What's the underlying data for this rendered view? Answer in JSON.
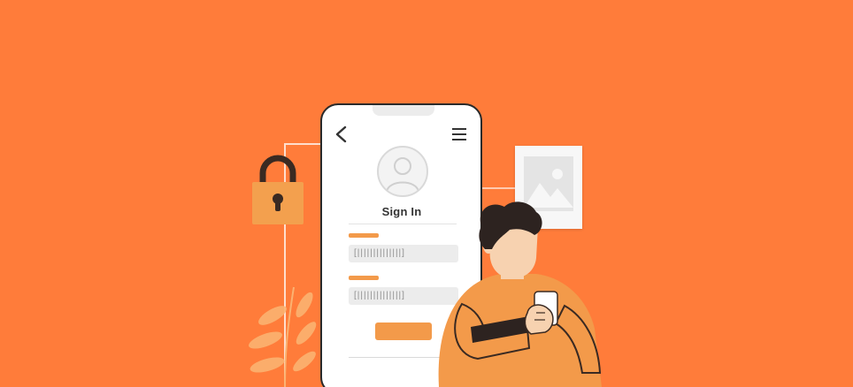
{
  "colors": {
    "background": "#FF7C3A",
    "accent": "#F39A4A",
    "phone_frame": "#2a2a2a",
    "lock": "#F3A04E"
  },
  "icons": {
    "back": "chevron-left-icon",
    "menu": "hamburger-menu-icon",
    "avatar": "user-avatar-icon",
    "lock": "padlock-icon",
    "photo": "image-placeholder-icon"
  },
  "phone": {
    "screen_title": "Sign In",
    "fields": [
      {
        "masked_value": "[||||||||||||||]"
      },
      {
        "masked_value": "[||||||||||||||]"
      }
    ]
  }
}
